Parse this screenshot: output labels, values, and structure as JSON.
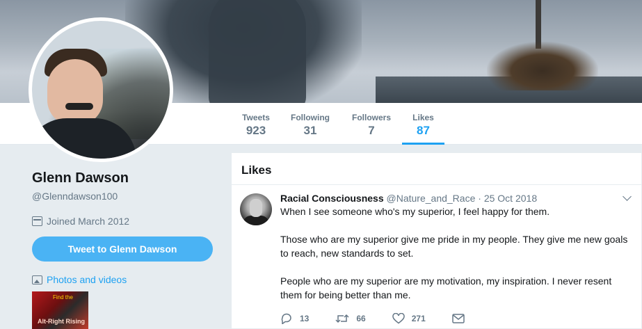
{
  "profile": {
    "name": "Glenn Dawson",
    "handle": "@Glenndawson100",
    "joined": "Joined March 2012",
    "tweet_button": "Tweet to Glenn Dawson",
    "photos_label": "Photos and videos",
    "thumbnail_text_top": "Find the",
    "thumbnail_text_bottom": "Alt-Right Rising"
  },
  "nav": {
    "stats": [
      {
        "label": "Tweets",
        "value": "923"
      },
      {
        "label": "Following",
        "value": "31"
      },
      {
        "label": "Followers",
        "value": "7"
      },
      {
        "label": "Likes",
        "value": "87"
      }
    ],
    "active": "Likes"
  },
  "timeline": {
    "title": "Likes",
    "tweet": {
      "author": "Racial Consciousness",
      "handle": "@Nature_and_Race",
      "separator": "·",
      "date": "25 Oct 2018",
      "paragraphs": [
        "When I see someone who's my superior, I feel happy for them.",
        "Those who are my superior give me pride in my people. They give me new goals to reach, new standards to set.",
        "People who are my superior are my motivation, my inspiration. I never resent them for being better than me."
      ],
      "replies": "13",
      "retweets": "66",
      "likes": "271"
    }
  },
  "colors": {
    "accent": "#1da1f2",
    "button": "#4ab3f4",
    "muted": "#657786",
    "background": "#e6ecf0"
  },
  "icons": [
    "calendar-icon",
    "image-icon",
    "reply-icon",
    "retweet-icon",
    "heart-icon",
    "message-icon",
    "chevron-down-icon"
  ]
}
